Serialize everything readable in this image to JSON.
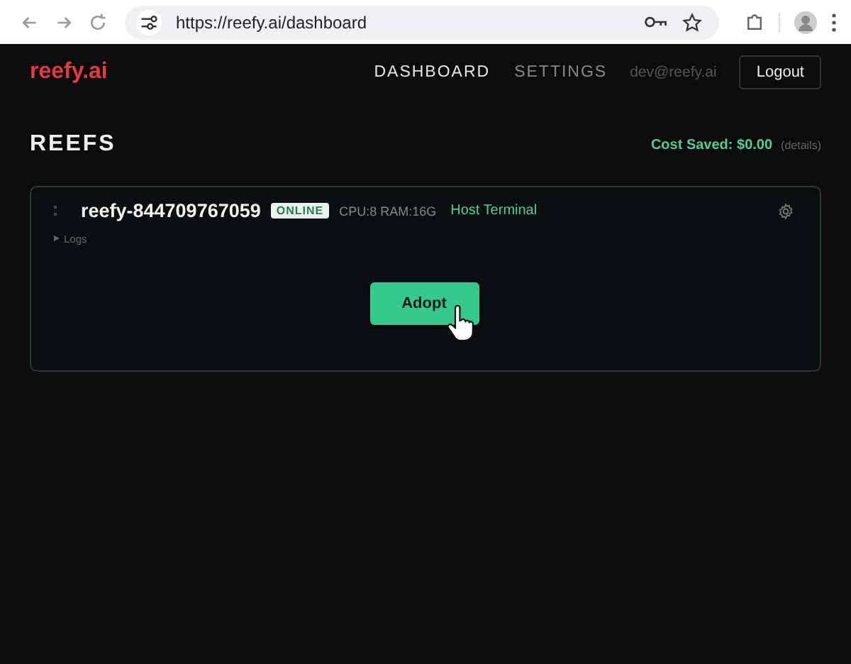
{
  "browser": {
    "url": "https://reefy.ai/dashboard"
  },
  "nav": {
    "logo": "reefy.ai",
    "links": [
      {
        "label": "DASHBOARD",
        "selected": true
      },
      {
        "label": "SETTINGS",
        "selected": false
      }
    ],
    "user": "dev@reefy.ai",
    "logout": "Logout"
  },
  "page": {
    "title": "REEFS",
    "cost_saved": "Cost Saved: $0.00",
    "details": "(details)"
  },
  "reefs": [
    {
      "name": "reefy-844709767059",
      "status": "ONLINE",
      "specs": "CPU:8 RAM:16G",
      "terminal": "Host Terminal",
      "logs": {
        "label": "Logs",
        "expanded": false
      },
      "action": "Adopt"
    }
  ]
}
